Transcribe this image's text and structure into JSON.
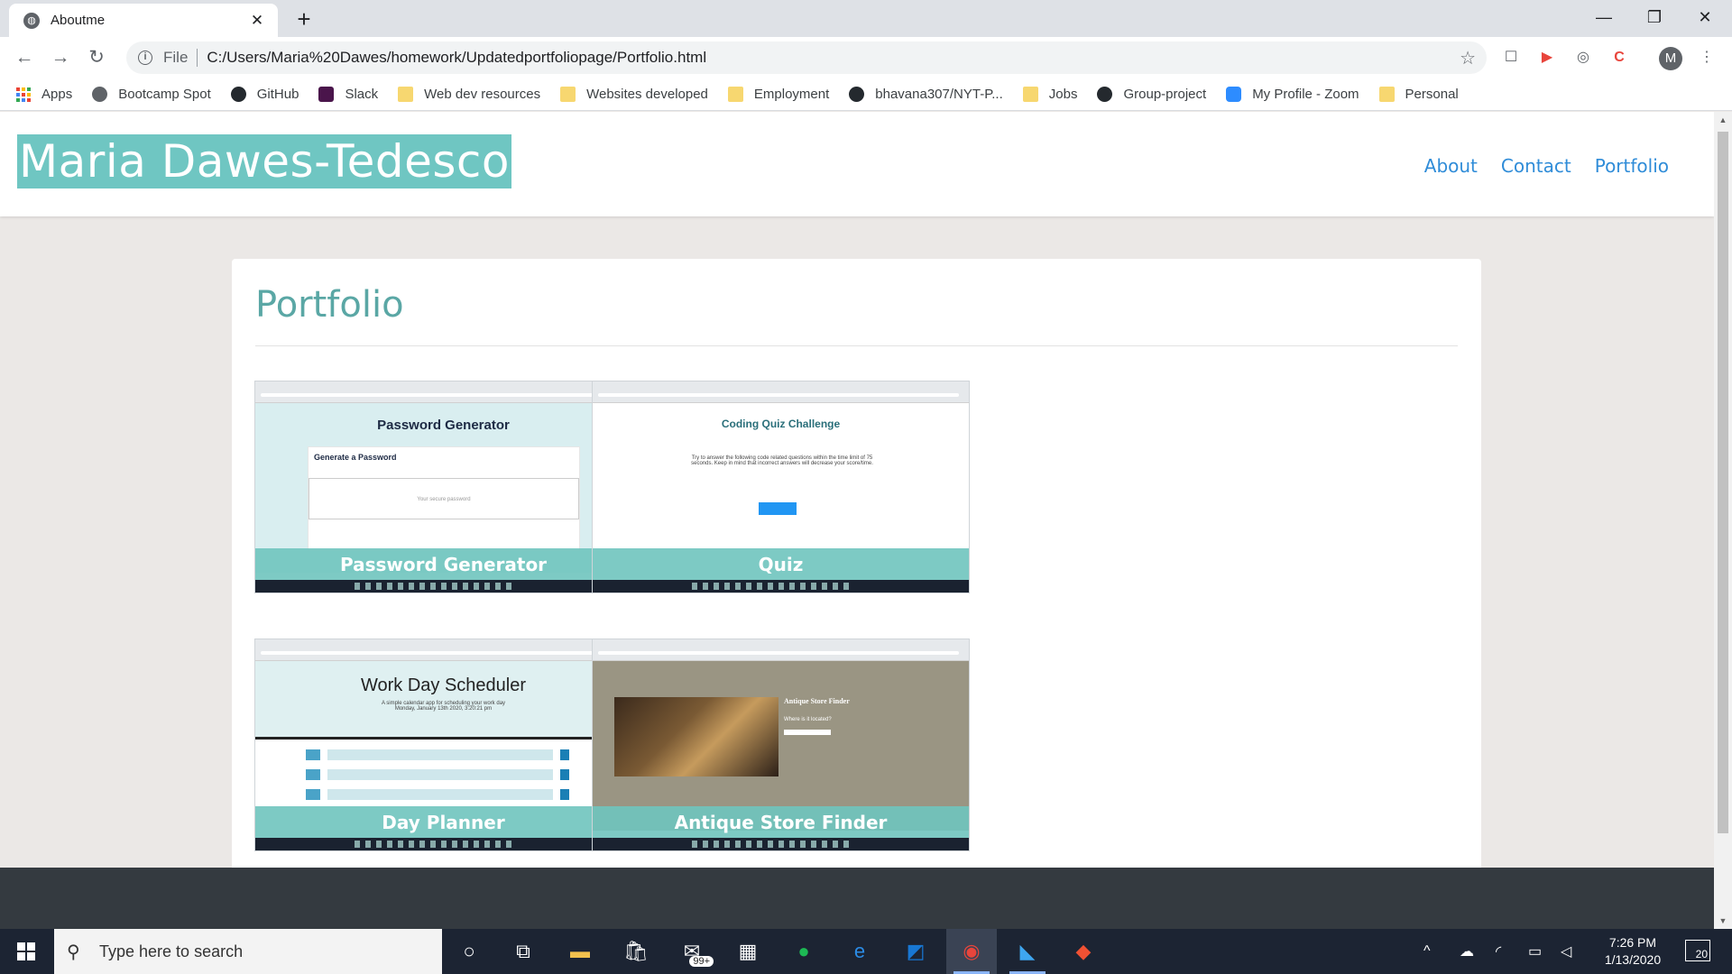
{
  "browser": {
    "tab": {
      "title": "Aboutme",
      "favicon": "globe-icon",
      "close": "✕"
    },
    "new_tab": "+",
    "window_controls": {
      "minimize": "—",
      "restore": "❐",
      "close": "✕"
    },
    "nav": {
      "back": "←",
      "forward": "→",
      "reload": "↻"
    },
    "omnibox": {
      "scheme": "File",
      "url": "C:/Users/Maria%20Dawes/homework/Updatedportfoliopage/Portfolio.html",
      "star": "☆"
    },
    "extensions": [
      "☐",
      "▶",
      "◎",
      "C"
    ],
    "profile": "M",
    "menu": "⋮",
    "bookmarks": [
      {
        "label": "Apps",
        "icon": "apps-grid-icon",
        "kind": "apps"
      },
      {
        "label": "Bootcamp Spot",
        "icon": "globe-icon",
        "kind": "globe"
      },
      {
        "label": "GitHub",
        "icon": "github-icon",
        "kind": "gh"
      },
      {
        "label": "Slack",
        "icon": "slack-icon",
        "kind": "slack"
      },
      {
        "label": "Web dev resources",
        "icon": "folder-icon",
        "kind": "folder"
      },
      {
        "label": "Websites developed",
        "icon": "folder-icon",
        "kind": "folder"
      },
      {
        "label": "Employment",
        "icon": "folder-icon",
        "kind": "folder"
      },
      {
        "label": "bhavana307/NYT-P...",
        "icon": "github-icon",
        "kind": "gh"
      },
      {
        "label": "Jobs",
        "icon": "folder-icon",
        "kind": "folder"
      },
      {
        "label": "Group-project",
        "icon": "github-icon",
        "kind": "gh"
      },
      {
        "label": "My Profile - Zoom",
        "icon": "zoom-icon",
        "kind": "zoom"
      },
      {
        "label": "Personal",
        "icon": "folder-icon",
        "kind": "folder"
      }
    ]
  },
  "site": {
    "name": "Maria Dawes-Tedesco",
    "nav": [
      "About",
      "Contact",
      "Portfolio"
    ],
    "page_title": "Portfolio",
    "projects": [
      {
        "caption": "Password Generator",
        "shot": "password",
        "inner": {
          "title": "Password Generator",
          "label": "Generate a Password",
          "placeholder": "Your secure password"
        }
      },
      {
        "caption": "Quiz",
        "shot": "quiz",
        "inner": {
          "title": "Coding Quiz Challenge",
          "text": "Try to answer the following code related questions within the time limit of 75 seconds. Keep in mind that incorrect answers will decrease your score/time.",
          "button": "Start"
        }
      },
      {
        "caption": "Day Planner",
        "shot": "planner",
        "inner": {
          "title": "Work Day Scheduler",
          "sub": "A simple calendar app for scheduling your work day",
          "date": "Monday, January 13th 2020, 3:20:21 pm"
        }
      },
      {
        "caption": "Antique Store Finder",
        "shot": "antique",
        "inner": {
          "title": "Antique Store Finder",
          "question": "Where is it located?"
        }
      }
    ]
  },
  "taskbar": {
    "search_placeholder": "Type here to search",
    "mail_badge": "99+",
    "time": "7:26 PM",
    "date": "1/13/2020",
    "notifications": "20"
  },
  "colors": {
    "accent_teal": "#6fc6c2",
    "heading_teal": "#5aa7a5",
    "nav_link": "#2f8cd8",
    "footer": "#343a40"
  }
}
